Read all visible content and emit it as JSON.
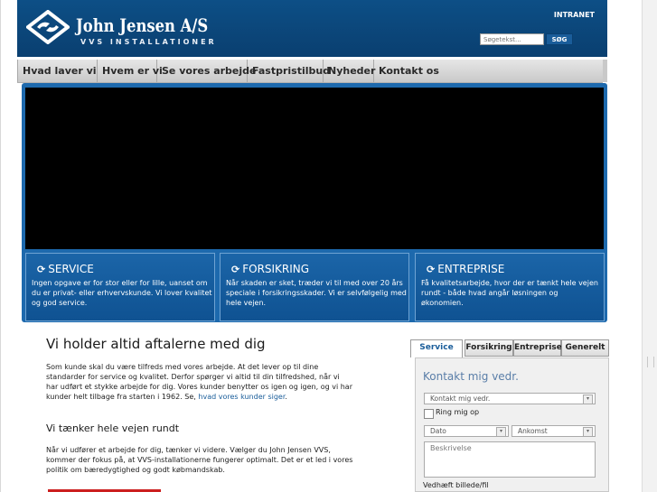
{
  "header": {
    "brand_name": "John Jensen A/S",
    "brand_sub": "VVS INSTALLATIONER",
    "intranet": "INTRANET",
    "search_placeholder": "Søgetekst...",
    "search_button": "SØG"
  },
  "nav": {
    "items": [
      "Hvad laver vi",
      "Hvem er vi",
      "Se vores arbejde",
      "Fastpristilbud",
      "Nyheder",
      "Kontakt os"
    ]
  },
  "promos": [
    {
      "title": "SERVICE",
      "text": "Ingen opgave er for stor eller for lille, uanset om du er privat- eller erhvervskunde. Vi lover kvalitet og god service."
    },
    {
      "title": "FORSIKRING",
      "text": "Når skaden er sket, træder vi til med over 20 års speciale i forsikringsskader. Vi er selvfølgelig med hele vejen."
    },
    {
      "title": "ENTREPRISE",
      "text": "Få kvalitetsarbejde, hvor der er tænkt hele vejen rundt - både hvad angår løsningen og økonomien."
    }
  ],
  "main": {
    "title": "Vi holder altid aftalerne med dig",
    "para1": "Som kunde skal du være tilfreds med vores arbejde. At det lever op til dine standarder for service og kvalitet. Derfor spørger vi altid til din tilfredshed, når vi har udført et stykke arbejde for dig. Vores kunder benytter os igen og igen, og vi har kunder helt tilbage fra starten i 1962. Se,",
    "para1_link": "hvad vores kunder siger",
    "subtitle": "Vi tænker hele vejen rundt",
    "para2": "Når vi udfører et arbejde for dig, tænker vi videre. Vælger du John Jensen VVS, kommer der fokus på, at VVS-installationerne fungerer optimalt. Det er et led i vores politik om bæredygtighed og godt købmandskab."
  },
  "sidebar": {
    "tabs": [
      "Service",
      "Forsikring",
      "Entreprise",
      "Generelt"
    ],
    "active_tab": "Service",
    "form_title": "Kontakt mig vedr.",
    "select_topic": "Kontakt mig vedr.",
    "checkbox_label": "Ring mig op",
    "checkbox_checked": false,
    "select_date": "Dato",
    "select_arrival": "Ankomst",
    "description_placeholder": "Beskrivelse",
    "attach_label": "Vedhæft billede/fil"
  },
  "colors": {
    "header_blue": "#0d4f86",
    "promo_blue": "#1b65a8",
    "link_blue": "#1a5d9a",
    "accent_red": "#cc1f1f"
  }
}
